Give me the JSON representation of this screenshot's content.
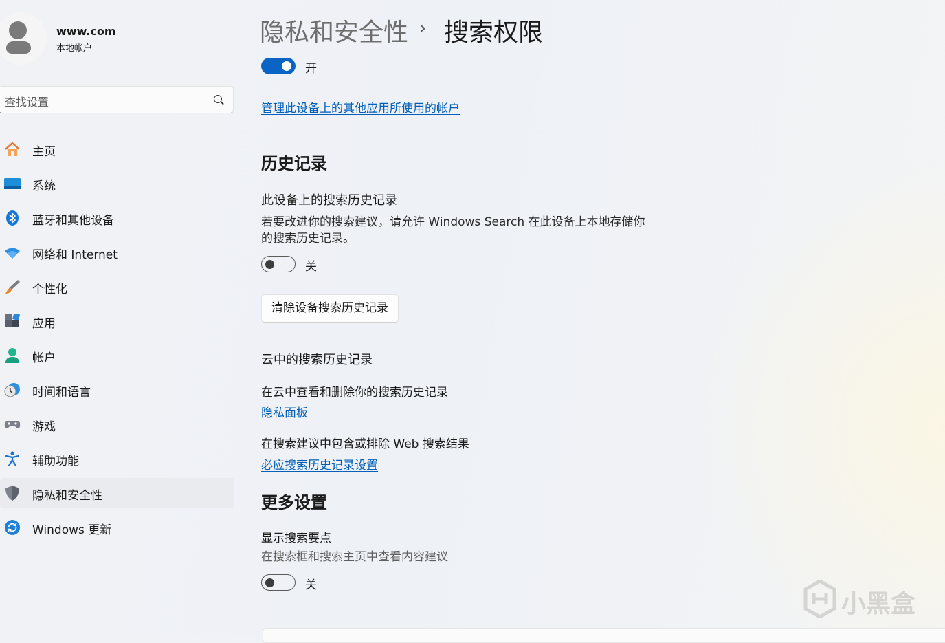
{
  "user": {
    "name": "www.com",
    "account_type": "本地帐户"
  },
  "search": {
    "placeholder": "查找设置",
    "icon": "search-icon"
  },
  "nav": [
    {
      "label": "主页",
      "icon": "home-icon"
    },
    {
      "label": "系统",
      "icon": "system-icon"
    },
    {
      "label": "蓝牙和其他设备",
      "icon": "bluetooth-icon"
    },
    {
      "label": "网络和 Internet",
      "icon": "wifi-icon"
    },
    {
      "label": "个性化",
      "icon": "brush-icon"
    },
    {
      "label": "应用",
      "icon": "apps-icon"
    },
    {
      "label": "帐户",
      "icon": "account-icon"
    },
    {
      "label": "时间和语言",
      "icon": "time-language-icon"
    },
    {
      "label": "游戏",
      "icon": "gamepad-icon"
    },
    {
      "label": "辅助功能",
      "icon": "accessibility-icon"
    },
    {
      "label": "隐私和安全性",
      "icon": "shield-icon",
      "selected": true
    },
    {
      "label": "Windows 更新",
      "icon": "windows-update-icon"
    }
  ],
  "breadcrumb": {
    "parent": "隐私和安全性",
    "separator": "›",
    "current": "搜索权限"
  },
  "top_toggle": {
    "state": "on",
    "label": "开"
  },
  "manage_link": "管理此设备上的其他应用所使用的帐户",
  "history": {
    "title": "历史记录",
    "device_history": {
      "title": "此设备上的搜索历史记录",
      "description": "若要改进你的搜索建议，请允许 Windows Search 在此设备上本地存储你的搜索历史记录。",
      "toggle_state": "off",
      "toggle_label": "关",
      "clear_button": "清除设备搜索历史记录"
    },
    "cloud": {
      "title": "云中的搜索历史记录",
      "view_delete_text": "在云中查看和删除你的搜索历史记录",
      "privacy_link": "隐私面板",
      "web_text": "在搜索建议中包含或排除 Web 搜索结果",
      "bing_link": "必应搜索历史记录设置"
    }
  },
  "more": {
    "title": "更多设置",
    "highlights_title": "显示搜索要点",
    "highlights_desc": "在搜索框和搜索主页中查看内容建议",
    "toggle_state": "off",
    "toggle_label": "关"
  },
  "watermark": {
    "text": "小黑盒"
  },
  "colors": {
    "accent": "#0a64c5",
    "link": "#005fb8",
    "selected_bg": "#e9ebee"
  }
}
